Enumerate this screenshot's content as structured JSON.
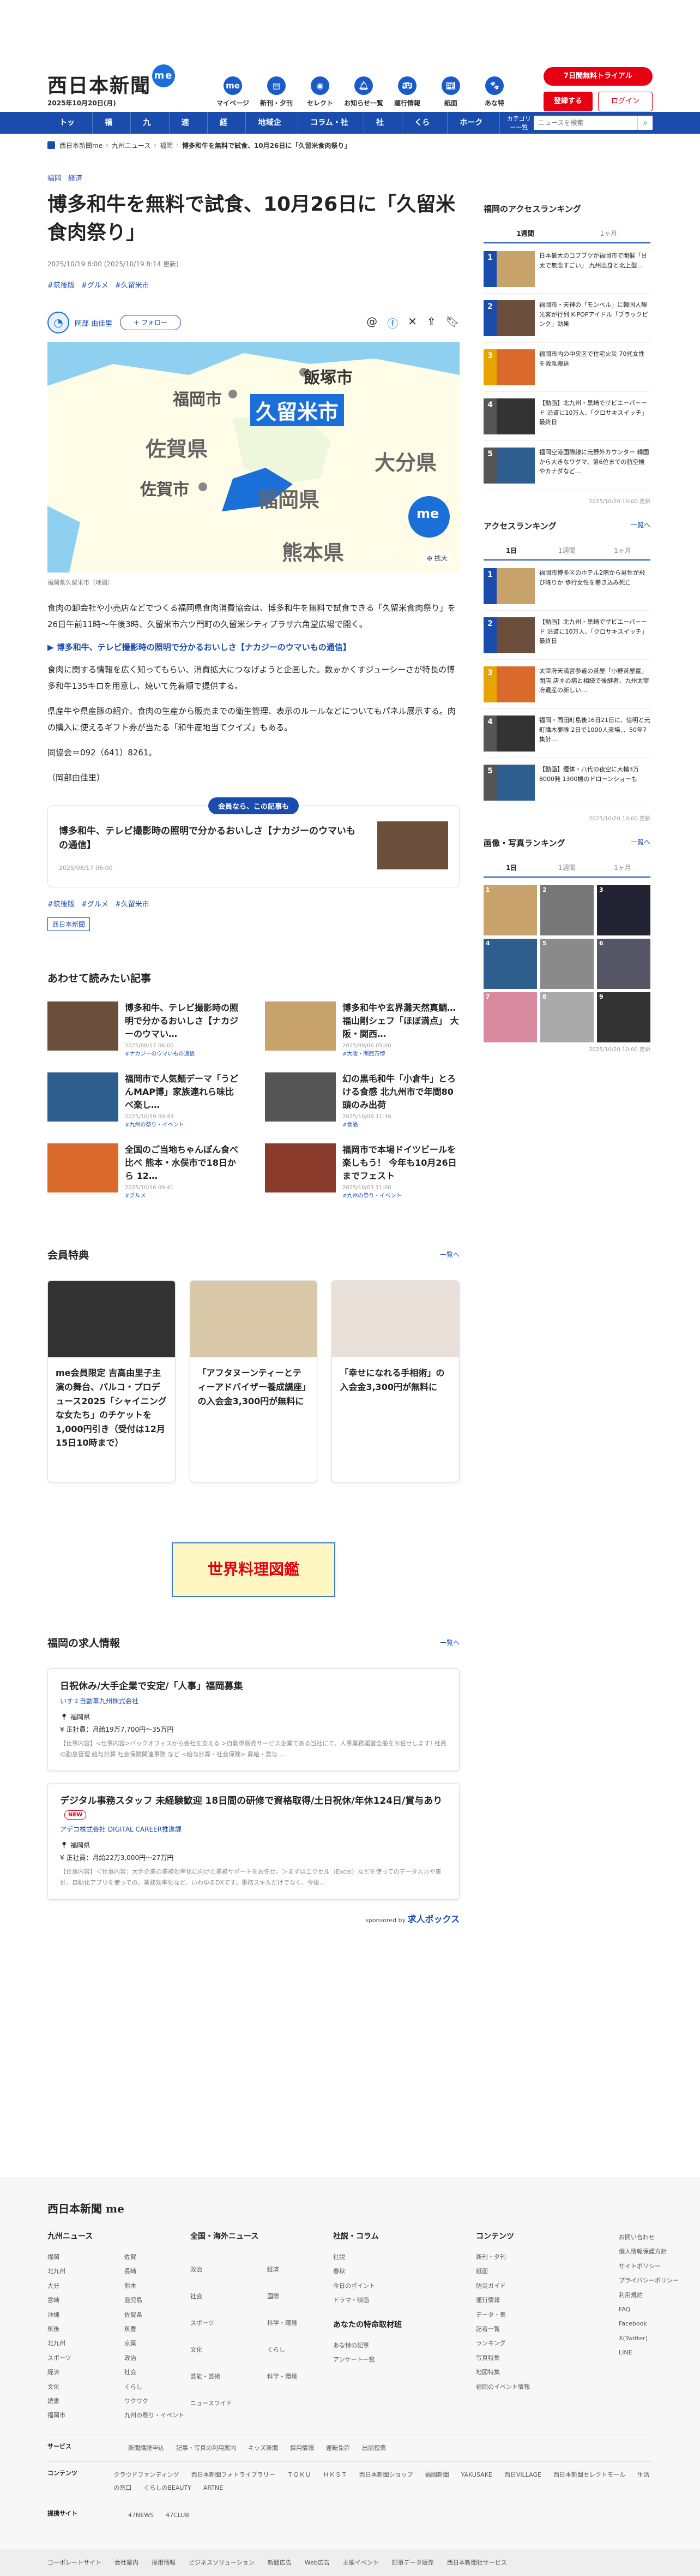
{
  "header": {
    "logo": "西日本新聞",
    "logo_badge": "me",
    "date": "2025年10月20日(月)",
    "icons": [
      {
        "icon": "me-icon",
        "label": "マイページ"
      },
      {
        "icon": "paper-icon",
        "label": "新刊・夕刊"
      },
      {
        "icon": "select-icon",
        "label": "セレクト"
      },
      {
        "icon": "bell-icon",
        "label": "お知らせ一覧"
      },
      {
        "icon": "bus-icon",
        "label": "運行情報"
      },
      {
        "icon": "newspaper-icon",
        "label": "紙面"
      },
      {
        "icon": "paw-icon",
        "label": "あな特"
      }
    ],
    "trial": "7日間無料トライアル",
    "register": "登録する",
    "login": "ログイン"
  },
  "nav": {
    "items": [
      "トップ",
      "福岡",
      "九州",
      "速報",
      "経済",
      "地域企業",
      "コラム・社説",
      "社会",
      "くらし",
      "ホークス"
    ],
    "category": "カテゴリー一覧",
    "search_placeholder": "ニュースを検索"
  },
  "breadcrumb": [
    "西日本新聞me",
    "九州ニュース",
    "福岡",
    "博多和牛を無料で試食、10月26日に「久留米食肉祭り」"
  ],
  "article": {
    "tags": [
      "福岡",
      "経済"
    ],
    "title": "博多和牛を無料で試食、10月26日に「久留米食肉祭り」",
    "published": "2025/10/19 8:00 (2025/10/19 8:14 更新)",
    "hashtags": [
      "#筑後版",
      "#グルメ",
      "#久留米市"
    ],
    "author": "岡部 由佳里",
    "follow": "+ フォロー",
    "map": {
      "labels": [
        "飯塚市",
        "福岡市",
        "久留米市",
        "佐賀県",
        "佐賀市",
        "福岡県",
        "大分県",
        "熊本県",
        "西日"
      ],
      "badge": "me",
      "zoom": "拡大"
    },
    "caption": "福岡県久留米市（地図）",
    "p1": "食肉の卸会社や小売店などでつくる福岡県食肉消費協会は、博多和牛を無料で試食できる「久留米食肉祭り」を26日午前11時～午後3時、久留米市六ツ門町の久留米シティプラザ六角堂広場で開く。",
    "link": "博多和牛、テレビ撮影時の照明で分かるおいしさ【ナカジーのウマいもの通信】",
    "p2": "食肉に関する情報を広く知ってもらい、消費拡大につなげようと企画した。数ゕかくすジューシーさが特長の博多和牛135キロを用意し、焼いて先着順で提供する。",
    "p3": "県産牛や県産豚の紹介、食肉の生産から販売までの衛生管理、表示のルールなどについてもパネル展示する。肉の購入に使えるギフト券が当たる「和牛産地当てクイズ」もある。",
    "p4": "同協会＝092（641）8261。",
    "p5": "（岡部由佳里）",
    "rec_label": "会員なら、この記事も",
    "rec_title": "博多和牛、テレビ撮影時の照明で分かるおいしさ【ナカジーのウマいもの通信】",
    "rec_date": "2025/08/17 06:00",
    "bottom_tags": [
      "#筑後版",
      "#グルメ",
      "#久留米市"
    ],
    "source": "西日本新聞"
  },
  "related": {
    "title": "あわせて読みたい記事",
    "items": [
      {
        "t": "博多和牛、テレビ撮影時の照明で分かるおいしさ【ナカジーのウマい…",
        "d": "2025/08/17 06:00",
        "g": "#ナカジーのウマいもの通信"
      },
      {
        "t": "博多和牛や玄界灘天然真鯛…福山剛シェフ「ほぼ満点」 大阪・関西…",
        "d": "2025/09/06 05:00",
        "g": "#大阪・関西万博"
      },
      {
        "t": "福岡市で人気麺デーマ「うどんMAP博」家族連れら味比べ楽し…",
        "d": "2025/10/19 09:43",
        "g": "#九州の祭り・イベント"
      },
      {
        "t": "幻の黒毛和牛「小倉牛」とろける食感 北九州市で年間80頭のみ出荷",
        "d": "2025/10/06 11:30",
        "g": "#食品"
      },
      {
        "t": "全国のご当地ちゃんぽん食べ比べ 熊本・水俣市で18日から 12…",
        "d": "2025/10/16 09:41",
        "g": "#グルメ"
      },
      {
        "t": "福岡市で本場ドイツビールを楽しもう！ 今年も10月26日までフェスト",
        "d": "2025/10/03 11:00",
        "g": "#九州の祭り・イベント"
      }
    ]
  },
  "membership": {
    "title": "会員特典",
    "more": "一覧へ",
    "cards": [
      "me会員限定 吉高由里子主演の舞台、パルコ・プロデュース2025「シャイニングな女たち」のチケットを1,000円引き（受付は12月15日10時まで）",
      "「アフタヌーンティーとティーアドバイザー養成講座」の入会金3,300円が無料に",
      "「幸せになれる手相術」の入会金3,300円が無料に"
    ]
  },
  "banner": "世界料理図鑑",
  "jobs": {
    "title": "福岡の求人情報",
    "more": "一覧へ",
    "items": [
      {
        "t": "日祝休み/大手企業で安定/「人事」福岡募集",
        "c": "いすゞ自動車九州株式会社",
        "loc": "福岡県",
        "pay": "正社員：月給19万7,700円〜35万円",
        "x": "【仕事内容】<仕事内容>バックオフィスから会社を支える >自動車販売サービス企業である当社にて、人事業務運営全般をお任せします! 社員の勤怠管理 給与計算 社会保険関連事務 など <給与計算・社会保険> 昇給・賞与 …"
      },
      {
        "t": "デジタル事務スタッフ 未経験歓迎 18日間の研修で資格取得/土日祝休/年休124日/賞与あり",
        "new": "NEW",
        "c": "アデコ株式会社 DIGITAL CAREER推進課",
        "loc": "福岡県",
        "pay": "正社員：月給22万3,000円〜27万円",
        "x": "【仕事内容】＜仕事内容：大手企業の業務効率化に向けた業務サポートをお任せ。＞まずはエクセル（Excel）などを使ってのデータ入力や集計、自動化アプリを使っての、業務効率化など、いわゆるDXです。事務スキルだけでなく、今後…"
      }
    ],
    "sponsor": "sponsored by",
    "sponsor_brand": "求人ボックス"
  },
  "sidebar": {
    "rank1_title": "福岡のアクセスランキング",
    "rank1_tabs": [
      "1週間",
      "1ヶ月"
    ],
    "rank1": [
      "日本最大のコプブツが福岡市で開催「甘太で無念すごい」 九州出身と北上型…",
      "福岡市・天神の「モンベル」に韓国人観光客が行列 K-POPアイドル「ブラックピンク」効果",
      "福岡市内の中央区で住宅火災 70代女性を救急搬送",
      "【動画】北九州・黒崎でザビエーパーード 沿道に10万人、「クロサキスイッチ」最終日",
      "福岡空港国際線に元野外カウンター 韓国から大きなワグマ、第6位までの航空機やカナダなど…"
    ],
    "rank1_upd": "2025/10/20 10:00 更新",
    "rank2_title": "アクセスランキング",
    "rank2_more": "一覧へ",
    "rank2_tabs": [
      "1日",
      "1週間",
      "1ヶ月"
    ],
    "rank2": [
      "福岡市博多区のホテル2階から男性が飛び降りか 歩行女性を巻き込み死亡",
      "【動画】北九州・黒崎でザビエーパーード 沿道に10万人、「クロサキスイッチ」最終日",
      "太宰府天満宮参道の茶屋「小野茶屋富」閉店 店主の病と相続で後継者、九州太宰府遺産の新しい…",
      "福岡・同田町島後16日21日に、信明と元町購木夢隊 2日で1000人来場、、50年7集計…",
      "【動画】煙体・八代の夜空に大輪3万8000発 1300機のドローンショーも"
    ],
    "rank2_upd": "2025/10/20 10:00 更新",
    "photo_title": "画像・写真ランキング",
    "photo_more": "一覧へ",
    "photo_tabs": [
      "1日",
      "1週間",
      "1ヶ月"
    ],
    "photo_upd": "2025/10/20 10:00 更新"
  },
  "footer": {
    "logo": "西日本新聞 me",
    "col1": {
      "h": "九州ニュース",
      "items": [
        "福岡",
        "佐賀",
        "北九州",
        "長崎",
        "大分",
        "熊本",
        "宮崎",
        "鹿児島",
        "沖縄",
        "佐賀県",
        "筑後",
        "筑豊",
        "北九州",
        "京築",
        "スポーツ",
        "政治",
        "経済",
        "社会",
        "文化",
        "くらし",
        "読書",
        "ワクワク",
        "福岡市",
        "九州の祭り・イベント"
      ]
    },
    "col2": {
      "h": "全国・海外ニュース",
      "items": [
        "政治",
        "経済",
        "社会",
        "国際",
        "スポーツ",
        "科学・環境",
        "文化",
        "くらし",
        "芸能・芸術",
        "科学・環境",
        "ニュースワイド"
      ]
    },
    "col3": {
      "h": "社説・コラム",
      "items": [
        "社説",
        "春秋",
        "今日のポイント",
        "ドラマ・映画"
      ],
      "h2": "あなたの特命取材班",
      "items2": [
        "あな特の記事",
        "アンケート一覧"
      ]
    },
    "col4": {
      "h": "コンテンツ",
      "items": [
        "新刊・夕刊",
        "紙面",
        "防災ガイド",
        "運行情報",
        "データ・集",
        "記者一覧",
        "ランキング",
        "写真特集",
        "地図特集",
        "福岡のイベント情報"
      ]
    },
    "col5": {
      "items": [
        "お問い合わせ",
        "個人情報保護方針",
        "サイトポリシー",
        "プライバシーポリシー",
        "利用規約",
        "FAQ",
        "Facebook",
        "X(Twitter)",
        "LINE"
      ]
    },
    "rows": [
      {
        "k": "サービス",
        "v": [
          "新聞購読申込",
          "記事・写真の利用案内",
          "キッズ新聞",
          "採用情報",
          "運転免許",
          "出前授業"
        ]
      },
      {
        "k": "コンテンツ",
        "v": [
          "クラウドファンディング",
          "西日本新聞フォトライブラリー",
          "ＴＯＫＵ",
          "ＨＫＳＴ",
          "西日本新聞ショップ",
          "福岡新聞",
          "YAKUSAKE",
          "西日VILLAGE",
          "西日本新聞セレクトモール",
          "生活の窓口",
          "くらしのBEAUTY",
          "ARTNE"
        ]
      },
      {
        "k": "提携サイト",
        "v": [
          "47NEWS",
          "47CLUB"
        ]
      }
    ],
    "bottom": [
      "コーポレートサイト",
      "会社案内",
      "採用情報",
      "ビジネスソリューション",
      "新聞広告",
      "Web広告",
      "主催イベント",
      "記事データ販売",
      "西日本新聞社サービス"
    ]
  }
}
